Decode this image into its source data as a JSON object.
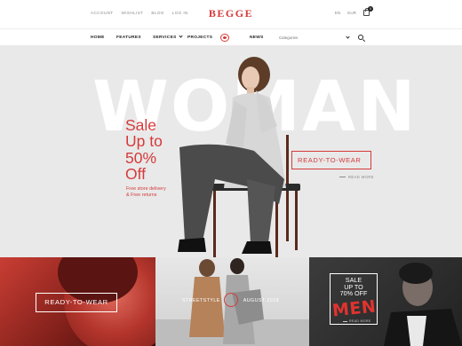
{
  "topbar": {
    "links": [
      "ACCOUNT",
      "WISHLIST",
      "BLOG",
      "LOG IN"
    ],
    "logo": "BEGGE",
    "language": "EN",
    "currency": "EUR",
    "cart_count": "0"
  },
  "nav": {
    "items": [
      "HOME",
      "FEATURES",
      "SERVICES",
      "PROJECTS",
      "NEWS"
    ],
    "search_placeholder": "Categories"
  },
  "hero": {
    "big_word": "WOMAN",
    "sale_lines": [
      "Sale",
      "Up to",
      "50%",
      "Off"
    ],
    "note_lines": [
      "Free store delivery",
      "& Free returns"
    ],
    "cta": "READY-TO-WEAR",
    "read_more": "READ MORE"
  },
  "banners": {
    "first": {
      "label": "READY-TO-WEAR"
    },
    "second": {
      "left": "STREETSTYLE",
      "right": "AUGUST 2018"
    },
    "third": {
      "sale_lines": [
        "SALE",
        "UP TO",
        "70% OFF"
      ],
      "men": "MEN",
      "read_more": "READ MORE"
    }
  },
  "colors": {
    "accent": "#d53a3a",
    "hero_bg": "#e9e9e9"
  }
}
